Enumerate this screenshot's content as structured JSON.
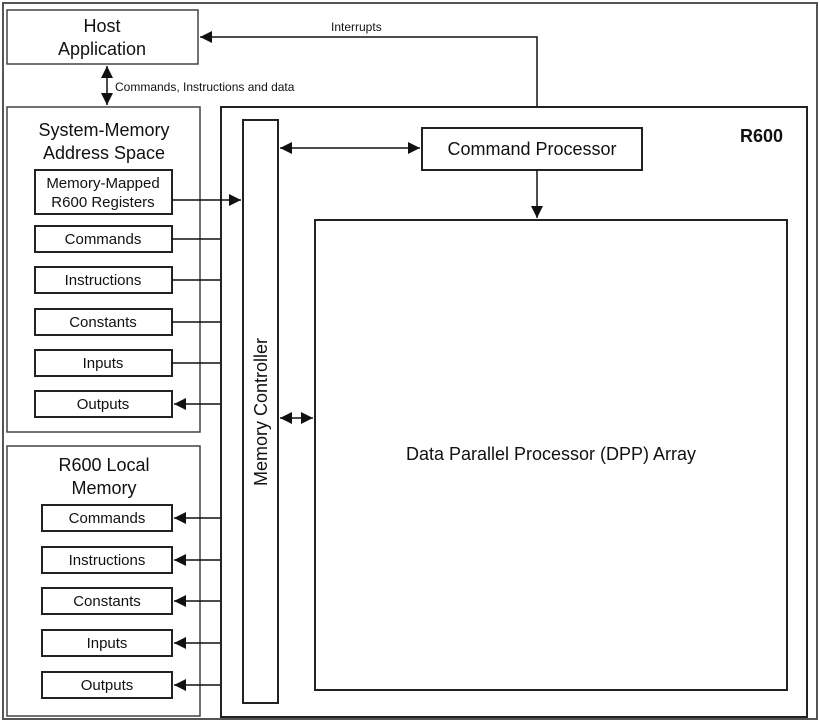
{
  "host": {
    "line1": "Host",
    "line2": "Application"
  },
  "labels": {
    "interrupts": "Interrupts",
    "host_link": "Commands, Instructions and data",
    "r600": "R600",
    "command_processor": "Command Processor",
    "memory_controller": "Memory Controller",
    "dpp": "Data Parallel Processor (DPP) Array"
  },
  "system_memory": {
    "title1": "System-Memory",
    "title2": "Address Space",
    "registers1": "Memory-Mapped",
    "registers2": "R600 Registers",
    "items": [
      "Commands",
      "Instructions",
      "Constants",
      "Inputs",
      "Outputs"
    ]
  },
  "local_memory": {
    "title1": "R600 Local",
    "title2": "Memory",
    "items": [
      "Commands",
      "Instructions",
      "Constants",
      "Inputs",
      "Outputs"
    ]
  }
}
